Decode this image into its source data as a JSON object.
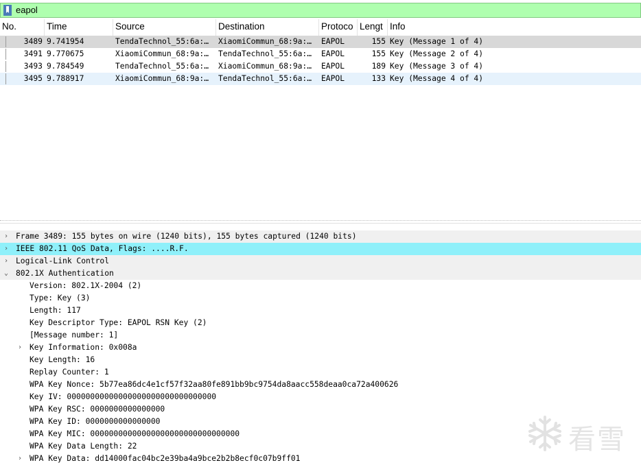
{
  "filter": {
    "value": "eapol"
  },
  "columns": {
    "no": "No.",
    "time": "Time",
    "source": "Source",
    "destination": "Destination",
    "protocol": "Protoco",
    "length": "Lengt",
    "info": "Info"
  },
  "packets": [
    {
      "no": "3489",
      "time": "9.741954",
      "source": "TendaTechnol_55:6a:…",
      "destination": "XiaomiCommun_68:9a:…",
      "protocol": "EAPOL",
      "length": "155",
      "info": "Key (Message 1 of 4)"
    },
    {
      "no": "3491",
      "time": "9.770675",
      "source": "XiaomiCommun_68:9a:…",
      "destination": "TendaTechnol_55:6a:…",
      "protocol": "EAPOL",
      "length": "155",
      "info": "Key (Message 2 of 4)"
    },
    {
      "no": "3493",
      "time": "9.784549",
      "source": "TendaTechnol_55:6a:…",
      "destination": "XiaomiCommun_68:9a:…",
      "protocol": "EAPOL",
      "length": "189",
      "info": "Key (Message 3 of 4)"
    },
    {
      "no": "3495",
      "time": "9.788917",
      "source": "XiaomiCommun_68:9a:…",
      "destination": "TendaTechnol_55:6a:…",
      "protocol": "EAPOL",
      "length": "133",
      "info": "Key (Message 4 of 4)"
    }
  ],
  "details": [
    {
      "text": "Frame 3489: 155 bytes on wire (1240 bits), 155 bytes captured (1240 bits)",
      "arrow": "›"
    },
    {
      "text": "IEEE 802.11 QoS Data, Flags: ....R.F.",
      "arrow": "›"
    },
    {
      "text": "Logical-Link Control",
      "arrow": "›"
    },
    {
      "text": "802.1X Authentication",
      "arrow": "⌄"
    },
    {
      "text": "Version: 802.1X-2004 (2)"
    },
    {
      "text": "Type: Key (3)"
    },
    {
      "text": "Length: 117"
    },
    {
      "text": "Key Descriptor Type: EAPOL RSN Key (2)"
    },
    {
      "text": "[Message number: 1]"
    },
    {
      "text": "Key Information: 0x008a",
      "arrow": "›"
    },
    {
      "text": "Key Length: 16"
    },
    {
      "text": "Replay Counter: 1"
    },
    {
      "text": "WPA Key Nonce: 5b77ea86dc4e1cf57f32aa80fe891bb9bc9754da8aacc558deaa0ca72a400626"
    },
    {
      "text": "Key IV: 00000000000000000000000000000000"
    },
    {
      "text": "WPA Key RSC: 0000000000000000"
    },
    {
      "text": "WPA Key ID: 0000000000000000"
    },
    {
      "text": "WPA Key MIC: 00000000000000000000000000000000"
    },
    {
      "text": "WPA Key Data Length: 22"
    },
    {
      "text": "WPA Key Data: dd14000fac04bc2e39ba4a9bce2b2b8ecf0c07b9ff01",
      "arrow": "›"
    }
  ],
  "watermark": {
    "text": "看雪"
  },
  "colors": {
    "filter_valid": "#afffaf",
    "selected_row": "#d8d8d8",
    "highlight_row": "#8ff0fa"
  }
}
